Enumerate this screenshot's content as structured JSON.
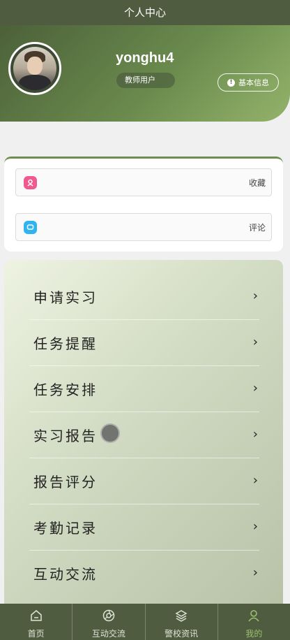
{
  "header": {
    "title": "个人中心"
  },
  "profile": {
    "username": "yonghu4",
    "role": "教师用户",
    "info_button": "基本信息"
  },
  "quick_links": [
    {
      "label": "收藏",
      "icon": "bookmark-icon",
      "color": "#f0598f"
    },
    {
      "label": "评论",
      "icon": "comment-icon",
      "color": "#2fb4f0"
    }
  ],
  "menu": [
    {
      "label": "申请实习"
    },
    {
      "label": "任务提醒"
    },
    {
      "label": "任务安排"
    },
    {
      "label": "实习报告"
    },
    {
      "label": "报告评分"
    },
    {
      "label": "考勤记录"
    },
    {
      "label": "互动交流"
    }
  ],
  "tabbar": [
    {
      "label": "首页",
      "icon": "home-icon"
    },
    {
      "label": "互动交流",
      "icon": "aperture-icon"
    },
    {
      "label": "警校资讯",
      "icon": "layers-icon"
    },
    {
      "label": "我的",
      "icon": "user-icon",
      "active": true
    }
  ],
  "colors": {
    "primary": "#4f5c3f",
    "accent": "#9cc070"
  }
}
